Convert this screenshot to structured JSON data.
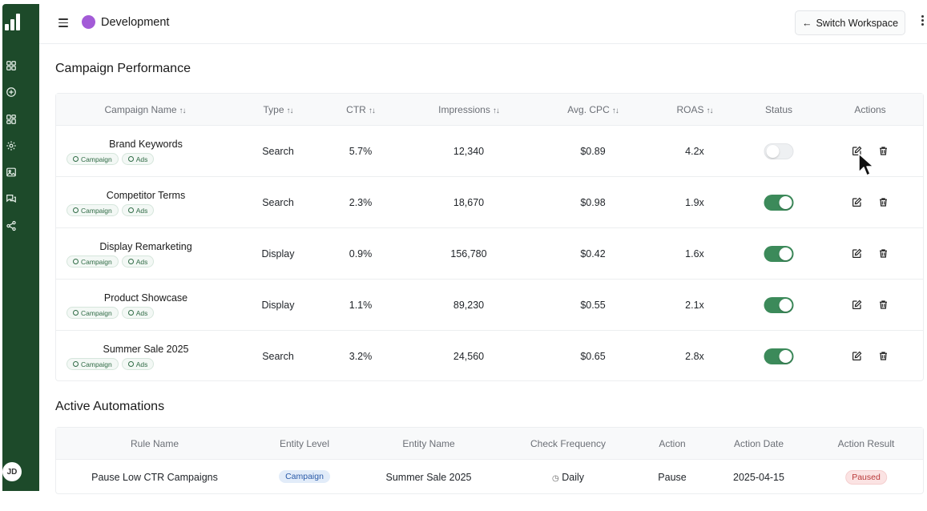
{
  "sidebar": {
    "icons": [
      "dashboard-icon",
      "add-circle-icon",
      "grid-icon",
      "settings-icon",
      "image-icon",
      "chat-icon",
      "share-icon"
    ],
    "avatar_initials": "JD",
    "bg_color": "#1d4a2a"
  },
  "header": {
    "workspace_name": "Development",
    "workspace_color": "#a35bd7",
    "switch_label": "Switch Workspace"
  },
  "campaigns": {
    "title": "Campaign Performance",
    "columns": [
      "Campaign Name",
      "Type",
      "CTR",
      "Impressions",
      "Avg. CPC",
      "ROAS",
      "Status",
      "Actions"
    ],
    "tag_labels": [
      "Campaign",
      "Ads"
    ],
    "rows": [
      {
        "name": "Brand Keywords",
        "type": "Search",
        "ctr": "5.7%",
        "impressions": "12,340",
        "cpc": "$0.89",
        "roas": "4.2x",
        "status": "off"
      },
      {
        "name": "Competitor Terms",
        "type": "Search",
        "ctr": "2.3%",
        "impressions": "18,670",
        "cpc": "$0.98",
        "roas": "1.9x",
        "status": "on"
      },
      {
        "name": "Display Remarketing",
        "type": "Display",
        "ctr": "0.9%",
        "impressions": "156,780",
        "cpc": "$0.42",
        "roas": "1.6x",
        "status": "on"
      },
      {
        "name": "Product Showcase",
        "type": "Display",
        "ctr": "1.1%",
        "impressions": "89,230",
        "cpc": "$0.55",
        "roas": "2.1x",
        "status": "on"
      },
      {
        "name": "Summer Sale 2025",
        "type": "Search",
        "ctr": "3.2%",
        "impressions": "24,560",
        "cpc": "$0.65",
        "roas": "2.8x",
        "status": "on"
      }
    ],
    "toggle_on_color": "#3c8a5a"
  },
  "automations": {
    "title": "Active Automations",
    "columns": [
      "Rule Name",
      "Entity Level",
      "Entity Name",
      "Check Frequency",
      "Action",
      "Action Date",
      "Action Result"
    ],
    "rows": [
      {
        "rule": "Pause Low CTR Campaigns",
        "level": "Campaign",
        "entity": "Summer Sale 2025",
        "frequency": "Daily",
        "action": "Pause",
        "date": "2025-04-15",
        "result": "Paused"
      }
    ]
  }
}
